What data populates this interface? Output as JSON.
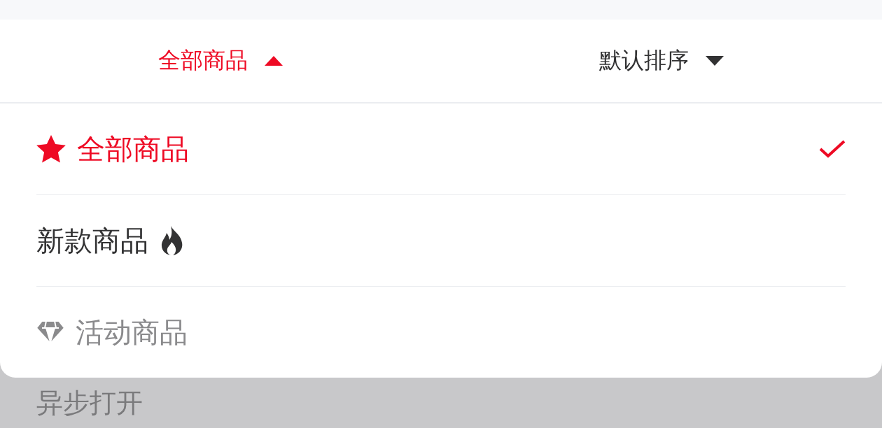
{
  "menu_bar": [
    {
      "title": "全部商品",
      "selected": true,
      "expanded": true
    },
    {
      "title": "默认排序",
      "selected": false,
      "expanded": false
    }
  ],
  "options": [
    {
      "label": "全部商品",
      "kind": "starred",
      "selected": true,
      "disabled": false
    },
    {
      "label": "新款商品",
      "kind": "hot",
      "selected": false,
      "disabled": false
    },
    {
      "label": "活动商品",
      "kind": "gem",
      "selected": false,
      "disabled": true
    }
  ],
  "behind": {
    "label": "异步打开"
  }
}
